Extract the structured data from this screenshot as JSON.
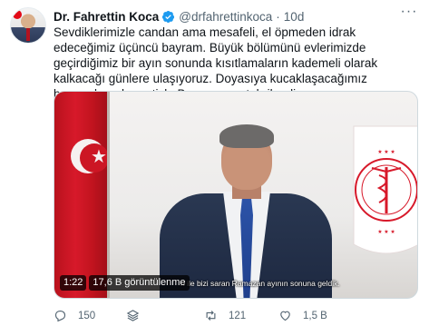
{
  "author": {
    "name": "Dr. Fahrettin Koca",
    "handle": "@drfahrettinkoca",
    "separator": "·",
    "time": "10d"
  },
  "tweet": {
    "text": "Sevdiklerimizle candan ama mesafeli, el öpmeden idrak edeceğimiz üçüncü bayram. Büyük bölümünü evlerimizde geçirdiğimiz bir ayın sonunda kısıtlamaların kademeli olarak kalkacağı günlere ulaşıyoruz. Doyasıya kucaklaşacağımız bayramların hasretiyle Bayramınızı tebrik ediyorum."
  },
  "media": {
    "duration": "1:22",
    "views": "17,6 B görüntülenme",
    "subtitle": "ri ile bizi saran Ramazan ayının sonuna geldik."
  },
  "actions": {
    "replies": "150",
    "retweets": "121",
    "likes": "1,5 B"
  },
  "colors": {
    "accent": "#1d9bf0",
    "muted": "#536471",
    "flag": "#d7192a"
  },
  "icons": [
    "verified-badge-icon",
    "more-icon",
    "reply-icon",
    "stack-icon",
    "retweet-icon",
    "like-icon"
  ]
}
